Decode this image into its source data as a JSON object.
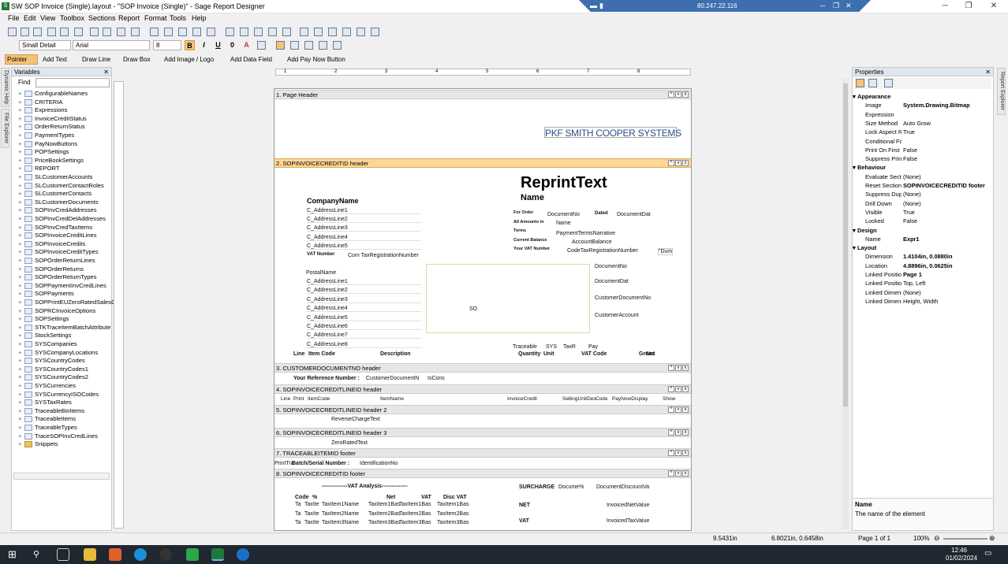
{
  "window": {
    "title": "SW SOP Invoice (Single).layout - \"SOP Invoice (Single)\" - Sage Report Designer",
    "remote_ip": "80.247.22.116"
  },
  "menu": [
    "File",
    "Edit",
    "View",
    "Toolbox",
    "Sections",
    "Report",
    "Format",
    "Tools",
    "Help"
  ],
  "format_bar": {
    "style": "Small Detail",
    "font": "Arial",
    "size": "8"
  },
  "tools": [
    "Pointer",
    "Add Text",
    "Draw Line",
    "Draw Box",
    "Add Image / Logo",
    "Add Data Field",
    "Add Pay Now Button"
  ],
  "side_tabs": {
    "left": [
      "Dynamic Help",
      "File Explorer"
    ],
    "right": [
      "Report Explorer"
    ]
  },
  "variables": {
    "title": "Variables",
    "find_label": "Find",
    "items": [
      "ConfigurableNames",
      "CRITERIA",
      "Expressions",
      "InvoiceCreditStatus",
      "OrderReturnStatus",
      "PaymentTypes",
      "PayNowButtons",
      "POPSettings",
      "PriceBookSettings",
      "REPORT",
      "SLCustomerAccounts",
      "SLCustomerContactRoles",
      "SLCustomerContacts",
      "SLCustomerDocuments",
      "SOPInvCredAddresses",
      "SOPInvCredDelAddresses",
      "SOPInvCredTaxItems",
      "SOPInvoiceCreditLines",
      "SOPInvoiceCredits",
      "SOPInvoiceCreditTypes",
      "SOPOrderReturnLines",
      "SOPOrderReturns",
      "SOPOrderReturnTypes",
      "SOPPaymentInvCredLines",
      "SOPPayments",
      "SOPPrintEUZeroRatedSalesO",
      "SOPRCInvoiceOptions",
      "SOPSettings",
      "STKTraceItemBatchAttribute",
      "StockSettings",
      "SYSCompanies",
      "SYSCompanyLocations",
      "SYSCountryCodes",
      "SYSCountryCodes1",
      "SYSCountryCodes2",
      "SYSCurrencies",
      "SYSCurrencyISOCodes",
      "SYSTaxRates",
      "TraceableBinItems",
      "TraceableItems",
      "TraceableTypes",
      "TraceSOPInvCredLines",
      "Snippets"
    ]
  },
  "ruler": [
    "1",
    "2",
    "3",
    "4",
    "5",
    "6",
    "7",
    "8"
  ],
  "sections": [
    "1. Page Header",
    "2. SOPINVOICECREDITID header",
    "3. CUSTOMERDOCUMENTNO header",
    "4. SOPINVOICECREDITLINEID header",
    "5. SOPINVOICECREDITLINEID header 2",
    "6. SOPINVOICECREDITLINEID header 3",
    "7. TRACEABLEITEMID footer",
    "8. SOPINVOICECREDITID footer"
  ],
  "report": {
    "logo": "PKF SMITH COOPER SYSTEMS",
    "reprint": "ReprintText",
    "name": "Name",
    "company": "CompanyName",
    "address": [
      "C_AddressLine1",
      "C_AddressLine2",
      "C_AddressLine3",
      "C_AddressLine4",
      "C_AddressLine5"
    ],
    "vat_label": "VAT Number",
    "vat_value": "Com TaxRegistrationNumber",
    "postal": "PostalName",
    "address2": [
      "C_AddressLine1",
      "C_AddressLine2",
      "C_AddressLine3",
      "C_AddressLine4",
      "C_AddressLine5",
      "C_AddressLine6",
      "C_AddressLine7",
      "C_AddressLine8"
    ],
    "labels": [
      "For Order",
      "All Amounts in",
      "Terms",
      "Current Balance",
      "Your VAT Number"
    ],
    "docno": "DocumentNo",
    "dated": "Dated",
    "docdate": "DocumentDat",
    "name2": "Name",
    "terms": "PaymentTermsNarrative",
    "balance": "AccountBalance",
    "custvat": "CodeTaxRegistrationNumber",
    "dum": "\"Dum",
    "right_fields": [
      "DocumentNo",
      "DocumentDat",
      "CustomerDocumentNo",
      "CustomerAccount"
    ],
    "so": "SO",
    "hdr_small": [
      "Traceable",
      "SYS",
      "TaxR",
      "Pay"
    ],
    "col_headers": [
      "Line",
      "Item Code",
      "Description",
      "Quantity",
      "Unit",
      "VAT Code",
      "Gross",
      "Net"
    ],
    "ref_label": "Your Reference Number :",
    "ref_value": "CustomerDocumentN",
    "iscons": "IsCons",
    "line_fields": [
      "Line",
      "Print",
      "ItemCode",
      "ItemName",
      "InvoiceCredit",
      "SellingUnitDes",
      "Code",
      "PayNowDisplay",
      "Show"
    ],
    "reverse": "ReverseChargeText",
    "zero": "ZeroRatedText",
    "print_trace": "PrintTra",
    "batch_label": "Batch/Serial Number :",
    "ident": "IdentificationNo",
    "vat_analysis": "--------------VAT Analysis--------------",
    "vat_cols": [
      "Code",
      "%",
      "Net",
      "VAT",
      "Disc VAT"
    ],
    "vat_rows": [
      [
        "Ta",
        "TaxIte",
        "TaxItem1Name",
        "TaxItem1Bas",
        "TaxItem1Bas",
        "TaxItem1Bas"
      ],
      [
        "Ta",
        "TaxIte",
        "TaxItem2Name",
        "TaxItem2Bas",
        "TaxItem2Bas",
        "TaxItem2Bas"
      ],
      [
        "Ta",
        "TaxIte",
        "TaxItem3Name",
        "TaxItem3Bas",
        "TaxItem3Bas",
        "TaxItem3Bas"
      ]
    ],
    "surcharge": "SURCHARGE",
    "discount_pct": "Docume%",
    "doc_discount": "DocumentDiscountVa",
    "net_label": "NET",
    "net_value": "InvoicedNetValue",
    "vat_label2": "VAT",
    "vat_value2": "InvoicedTaxValue"
  },
  "properties": {
    "title": "Properties",
    "rows": [
      {
        "cat": "Appearance"
      },
      {
        "k": "Image",
        "v": "System.Drawing.Bitmap",
        "b": true
      },
      {
        "k": "Expression",
        "v": ""
      },
      {
        "k": "Size Method",
        "v": "Auto Grow"
      },
      {
        "k": "Lock Aspect Ra",
        "v": "True"
      },
      {
        "k": "Conditional Fo",
        "v": ""
      },
      {
        "k": "Print On First (",
        "v": "False"
      },
      {
        "k": "Suppress Print",
        "v": "False"
      },
      {
        "cat": "Behaviour"
      },
      {
        "k": "Evaluate Secti",
        "v": "(None)"
      },
      {
        "k": "Reset Section",
        "v": "SOPINVOICECREDITID footer",
        "b": true
      },
      {
        "k": "Suppress Dupl",
        "v": "(None)"
      },
      {
        "k": "Drill Down",
        "v": "(None)"
      },
      {
        "k": "Visible",
        "v": "True"
      },
      {
        "k": "Locked",
        "v": "False"
      },
      {
        "cat": "Design"
      },
      {
        "k": "Name",
        "v": "Expr1",
        "b": true
      },
      {
        "cat": "Layout"
      },
      {
        "k": "Dimension",
        "v": "1.4104in, 0.0880in",
        "b": true
      },
      {
        "k": "Location",
        "v": "4.8896in, 0.0625in",
        "b": true
      },
      {
        "k": "Linked Position",
        "v": "Page 1",
        "b": true
      },
      {
        "k": "Linked Position",
        "v": "Top, Left"
      },
      {
        "k": "Linked Dimensi",
        "v": "(None)"
      },
      {
        "k": "Linked Dimensi",
        "v": "Height, Width"
      }
    ],
    "help_title": "Name",
    "help_text": "The name of the element"
  },
  "status": {
    "pos": "9.5431in",
    "dims": "6.8021in, 0.6458in",
    "page": "Page 1 of 1",
    "zoom": "100%"
  },
  "taskbar": {
    "time": "12:46",
    "date": "01/02/2024"
  }
}
